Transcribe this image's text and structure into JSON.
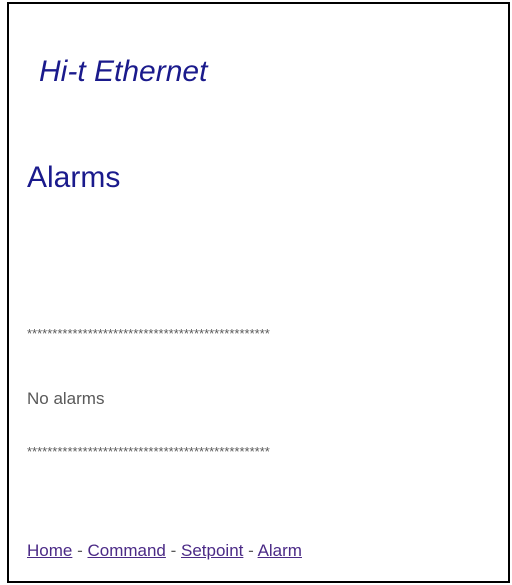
{
  "header": {
    "app_title": "Hi-t Ethernet",
    "page_title": "Alarms"
  },
  "content": {
    "separator": "************************************************",
    "status_text": "No alarms"
  },
  "nav": {
    "items": [
      {
        "label": "Home"
      },
      {
        "label": "Command"
      },
      {
        "label": "Setpoint"
      },
      {
        "label": "Alarm"
      }
    ],
    "divider": " - "
  },
  "colors": {
    "title": "#1a1a8c",
    "body_text": "#595959",
    "link": "#4b2a86",
    "border": "#000000"
  }
}
